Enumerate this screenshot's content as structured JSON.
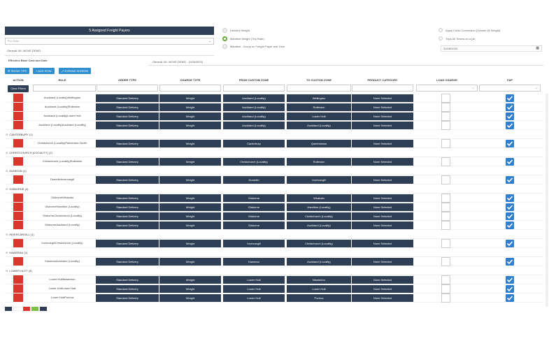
{
  "header": {
    "title": "5 Assigned Freight Payers",
    "select_placeholder": "Pro Rata",
    "account_label": "General UK: MOVE DEMO",
    "effective_label": "Effective Base Card and Date",
    "effective_value": "General UK: MOVE DEMO - (1/08/2023)"
  },
  "options": {
    "radio1": "Delivery Weight",
    "radio2": "Manifest Weight (Trip Rate)",
    "radio3": "Manifest - Group on Freight Payer and Zone",
    "check1": "Apply Cubic Conversion (Volume @ Weight)",
    "check2": "Trips All Timers on a job",
    "date_value": "31/08/2023"
  },
  "toolbar": {
    "show_tips": "SHOW TIPS",
    "add_row": "ADD ROW",
    "expand_screen": "EXPAND SCREEN"
  },
  "columns": {
    "action": "ACTION",
    "rule": "RULE",
    "order_type": "ORDER TYPE",
    "charge_type": "CHARGE TYPE",
    "from_zone": "FROM CUSTOM ZONE",
    "to_zone": "TO CUSTOM ZONE",
    "product": "PRODUCT CATEGORY",
    "load_charge": "LOAD CHARGE",
    "fap": "FAP"
  },
  "clear_filters": "Clear Filters",
  "groups": [
    {
      "label": "",
      "rows": [
        {
          "rule": "Auckland (Locality)Wellington",
          "order": "Standard Delivery",
          "charge": "Weight",
          "from": "Auckland (Locality)",
          "to": "Wellington",
          "product": "None Selected"
        },
        {
          "rule": "Auckland (Locality)Rolleston",
          "order": "Standard Delivery",
          "charge": "Weight",
          "from": "Auckland (Locality)",
          "to": "Rolleston",
          "product": "None Selected"
        },
        {
          "rule": "Auckland (Locality)Lower Hutt",
          "order": "Standard Delivery",
          "charge": "Weight",
          "from": "Auckland (Locality)",
          "to": "Lower Hutt",
          "product": "None Selected"
        },
        {
          "rule": "Auckland (Locality)Auckland (Locality)",
          "order": "Standard Delivery",
          "charge": "Weight",
          "from": "Auckland (Locality)",
          "to": "Auckland (Locality)",
          "product": "None Selected"
        }
      ]
    },
    {
      "label": "CANTERBURY (1)",
      "rows": [
        {
          "rule": "Christchurch (Locality)Palmerston North",
          "order": "Standard Delivery",
          "charge": "Weight",
          "from": "Canterbury",
          "to": "Queenstown",
          "product": "None Selected"
        }
      ]
    },
    {
      "label": "CHRISTCHURCH (LOCALITY) (1)",
      "rows": [
        {
          "rule": "Christchurch (Locality)Rolleston",
          "order": "Standard Delivery",
          "charge": "Weight",
          "from": "Christchurch (Locality)",
          "to": "Rolleston",
          "product": "None Selected"
        }
      ]
    },
    {
      "label": "DUNEDIN (1)",
      "rows": [
        {
          "rule": "DunedinInvercargill",
          "order": "Standard Delivery",
          "charge": "Weight",
          "from": "Dunedin",
          "to": "Invercargill",
          "product": "None Selected"
        }
      ]
    },
    {
      "label": "GISBORNE (4)",
      "rows": [
        {
          "rule": "GisborneWhakatu",
          "order": "Standard Delivery",
          "charge": "Weight",
          "from": "Gisborne",
          "to": "Whakatu",
          "product": "None Selected"
        },
        {
          "rule": "GisborneHamilton (Locality)",
          "order": "Standard Delivery",
          "charge": "Weight",
          "from": "Gisborne",
          "to": "Hamilton (Locality)",
          "product": "None Selected"
        },
        {
          "rule": "GisborneChristchurch (Locality)",
          "order": "Standard Delivery",
          "charge": "Weight",
          "from": "Gisborne",
          "to": "Christchurch (Locality)",
          "product": "None Selected"
        },
        {
          "rule": "GisborneAuckland (Locality)",
          "order": "Standard Delivery",
          "charge": "Weight",
          "from": "Gisborne",
          "to": "Auckland (Locality)",
          "product": "None Selected"
        }
      ]
    },
    {
      "label": "INVERCARGILL (1)",
      "rows": [
        {
          "rule": "InvercargillChristchurch (Locality)",
          "order": "Standard Delivery",
          "charge": "Weight",
          "from": "Invercargill",
          "to": "Christchurch (Locality)",
          "product": "None Selected"
        }
      ]
    },
    {
      "label": "KAWERAU (1)",
      "rows": [
        {
          "rule": "KawerauAuckland (Locality)",
          "order": "Standard Delivery",
          "charge": "Weight",
          "from": "Kawerau",
          "to": "Auckland (Locality)",
          "product": "None Selected"
        }
      ]
    },
    {
      "label": "LOWER HUTT (3)",
      "rows": [
        {
          "rule": "Lower HuttMasterton",
          "order": "Standard Delivery",
          "charge": "Weight",
          "from": "Lower Hutt",
          "to": "Masterton",
          "product": "None Selected"
        },
        {
          "rule": "Lower HuttLower Hutt",
          "order": "Standard Delivery",
          "charge": "Weight",
          "from": "Lower Hutt",
          "to": "Lower Hutt",
          "product": "None Selected"
        },
        {
          "rule": "Lower HuttPorirua",
          "order": "Standard Delivery",
          "charge": "Weight",
          "from": "Lower Hutt",
          "to": "Porirua",
          "product": "None Selected"
        }
      ]
    }
  ],
  "colors": {
    "navy": "#2e3f55",
    "red": "#d9372b",
    "blue": "#2f7fd0",
    "green": "#7ac143"
  }
}
